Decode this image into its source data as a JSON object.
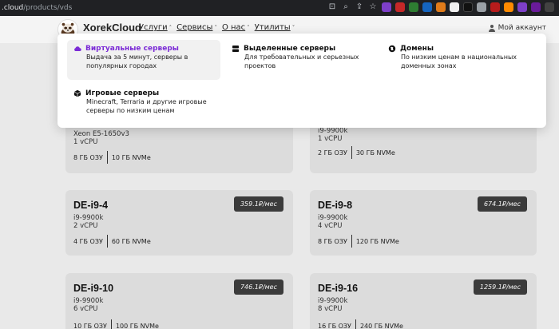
{
  "browser": {
    "url_host": ".cloud",
    "url_path": "/products/vds"
  },
  "header": {
    "brand": "XorekCloud",
    "nav": [
      {
        "label": "Услуги",
        "chevron": "˄"
      },
      {
        "label": "Сервисы",
        "chevron": "˅"
      },
      {
        "label": "О нас",
        "chevron": "˅"
      },
      {
        "label": "Утилиты",
        "chevron": "˅"
      }
    ],
    "account": "Мой аккаунт"
  },
  "dropdown": {
    "items": [
      {
        "title": "Виртуальные серверы",
        "desc1": "Выдача за 5 минут, серверы в",
        "desc2": "популярных городах",
        "icon": "cloud-icon",
        "active": true
      },
      {
        "title": "Выделенные серверы",
        "desc1": "Для требовательных и серьезных",
        "desc2": "проектов",
        "icon": "server-icon"
      },
      {
        "title": "Домены",
        "desc1": "По низким ценам в национальных",
        "desc2": "доменных зонах",
        "icon": "globe-icon"
      },
      {
        "title": "Игровые серверы",
        "desc1": "Minecraft, Terraria и другие игровые",
        "desc2": "серверы по низким ценам",
        "icon": "cube-icon"
      }
    ]
  },
  "cards": [
    {
      "title": "",
      "cpu": "Xeon E5-1650v3",
      "vcpu": "1 vCPU",
      "ram": "8 ГБ ОЗУ",
      "disk": "10 ГБ NVMe",
      "price": ""
    },
    {
      "title": "",
      "cpu": "i9-9900k",
      "vcpu": "1 vCPU",
      "ram": "2 ГБ ОЗУ",
      "disk": "30 ГБ NVMe",
      "price": ""
    },
    {
      "title": "DE-i9-4",
      "cpu": "i9-9900k",
      "vcpu": "2 vCPU",
      "ram": "4 ГБ ОЗУ",
      "disk": "60 ГБ NVMe",
      "price": "359.1₽/мес"
    },
    {
      "title": "DE-i9-8",
      "cpu": "i9-9900k",
      "vcpu": "4 vCPU",
      "ram": "8 ГБ ОЗУ",
      "disk": "120 ГБ NVMe",
      "price": "674.1₽/мес"
    },
    {
      "title": "DE-i9-10",
      "cpu": "i9-9900k",
      "vcpu": "6 vCPU",
      "ram": "10 ГБ ОЗУ",
      "disk": "100 ГБ NVMe",
      "price": "746.1₽/мес"
    },
    {
      "title": "DE-i9-16",
      "cpu": "i9-9900k",
      "vcpu": "8 vCPU",
      "ram": "16 ГБ ОЗУ",
      "disk": "240 ГБ NVMe",
      "price": "1259.1₽/мес"
    }
  ]
}
